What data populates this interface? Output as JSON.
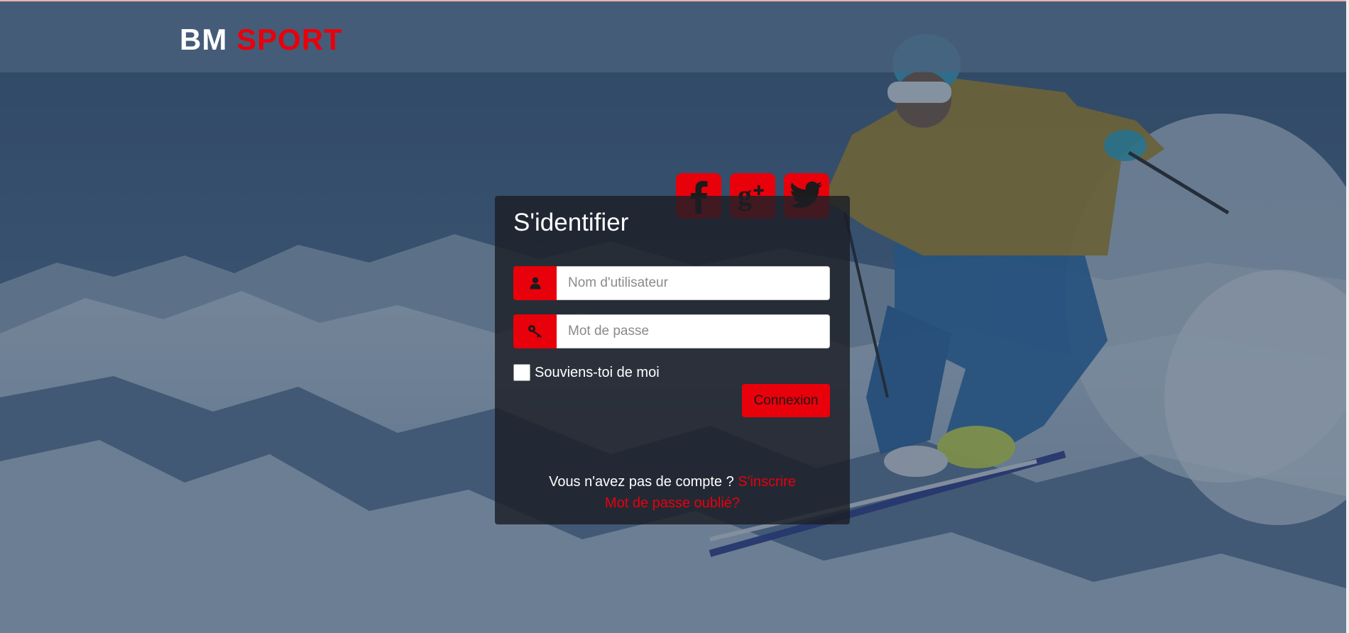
{
  "brand": {
    "part1": "BM",
    "part2": "SPORT"
  },
  "social": [
    {
      "name": "facebook",
      "icon": "facebook-icon"
    },
    {
      "name": "google-plus",
      "icon": "google-plus-icon"
    },
    {
      "name": "twitter",
      "icon": "twitter-icon"
    }
  ],
  "login": {
    "title": "S'identifier",
    "username_placeholder": "Nom d'utilisateur",
    "username_value": "",
    "password_placeholder": "Mot de passe",
    "password_value": "",
    "remember_label": "Souviens-toi de moi",
    "remember_checked": false,
    "submit_label": "Connexion",
    "no_account_text": "Vous n'avez pas de compte ?",
    "signup_link": "S'inscrire",
    "forgot_link": "Mot de passe oublié?"
  },
  "colors": {
    "accent": "#e8000b",
    "header_bg": "#4b627d",
    "card_bg": "#1c1f26"
  },
  "icons": {
    "username": "user-icon",
    "password": "key-icon"
  }
}
